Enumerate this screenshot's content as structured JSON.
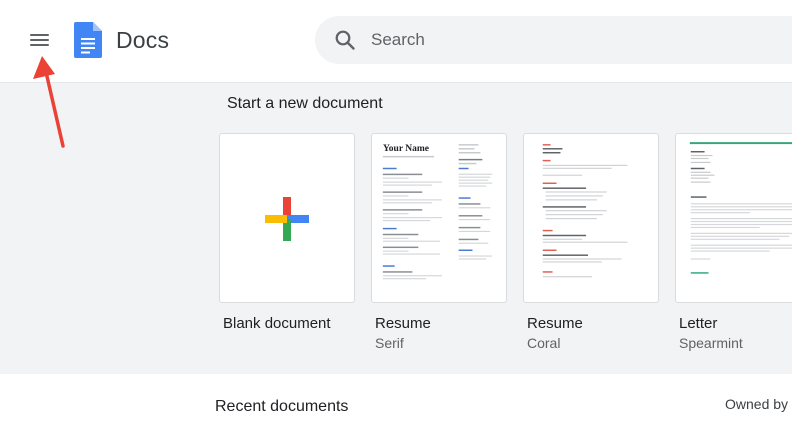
{
  "app": {
    "title": "Docs"
  },
  "search": {
    "placeholder": "Search"
  },
  "templates": {
    "section_title": "Start a new document",
    "items": [
      {
        "name": "Blank document",
        "subtitle": ""
      },
      {
        "name": "Resume",
        "subtitle": "Serif",
        "preview_heading": "Your Name"
      },
      {
        "name": "Resume",
        "subtitle": "Coral"
      },
      {
        "name": "Letter",
        "subtitle": "Spearmint"
      }
    ]
  },
  "recent": {
    "title": "Recent documents",
    "owned_by_label": "Owned by"
  },
  "colors": {
    "accent_blue": "#4285f4",
    "google_red": "#ea4335",
    "google_yellow": "#fbbc04",
    "google_green": "#34a853",
    "spearmint": "#35a77c",
    "coral": "#e06055",
    "annotation_arrow": "#ea4335"
  },
  "icons": {
    "menu": "hamburger-menu-icon",
    "logo": "docs-logo-icon",
    "search": "search-icon",
    "plus": "plus-icon",
    "annotation": "arrow-annotation-icon"
  }
}
